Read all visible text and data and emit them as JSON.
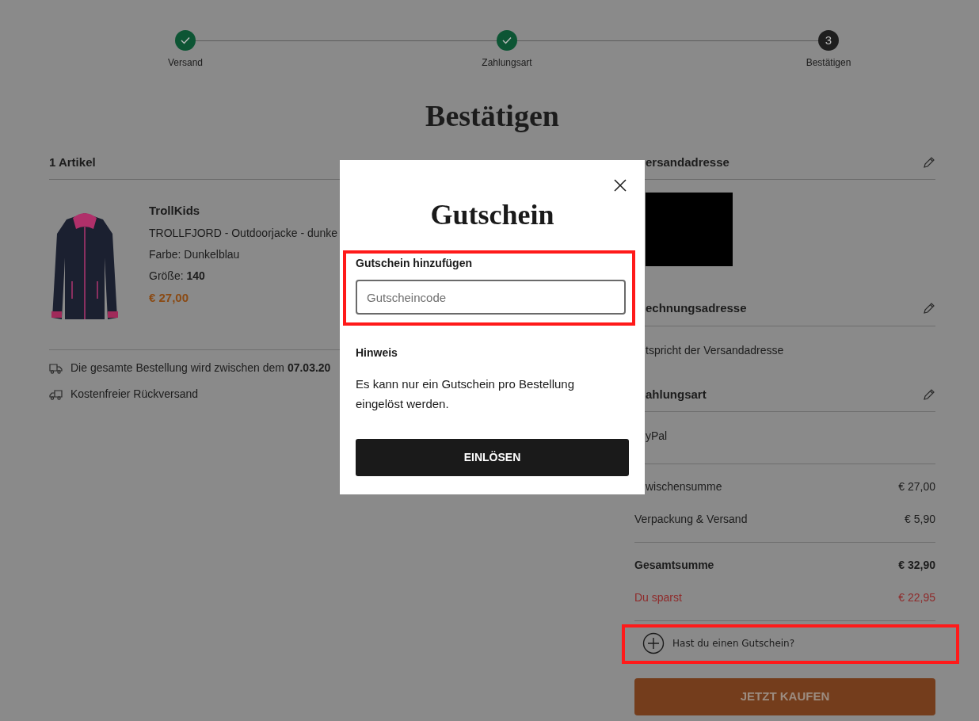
{
  "steps": [
    {
      "label": "Versand",
      "completed": true
    },
    {
      "label": "Zahlungsart",
      "completed": true
    },
    {
      "label": "Bestätigen",
      "number": "3",
      "completed": false
    }
  ],
  "title": "Bestätigen",
  "cart": {
    "heading": "1 Artikel",
    "items": [
      {
        "brand": "TrollKids",
        "name": "TROLLFJORD - Outdoorjacke - dunke",
        "variant": "Farbe: Dunkelblau",
        "size": "Größe: **140**",
        "price": "€ 27,00"
      }
    ]
  },
  "notes": [
    {
      "kind": "delivery",
      "text": "Die gesamte Bestellung wird zwischen dem **07.03.20**"
    },
    {
      "kind": "return",
      "text": "Kostenfreier Rückversand"
    }
  ],
  "sections": [
    {
      "title": "ersandadresse",
      "editable": true,
      "kind": "redacted"
    },
    {
      "title": "echnungsadresse",
      "editable": true,
      "kind": "text",
      "text": "tspricht der Versandadresse"
    },
    {
      "title": "ahlungsart",
      "editable": true,
      "kind": "text",
      "text": "yPal"
    }
  ],
  "totals": [
    {
      "label": "wischensumme",
      "value": "€ 27,00",
      "kind": "plain"
    },
    {
      "label": "Verpackung & Versand",
      "value": "€ 5,90",
      "kind": "plain"
    },
    {
      "label": "Gesamtsumme",
      "value": "€ 32,90",
      "kind": "total"
    },
    {
      "label": "Du sparst",
      "value": "€ 22,95",
      "kind": "savings"
    }
  ],
  "voucher_toggle": {
    "label": "Hast du einen Gutschein?"
  },
  "buy_button": "JETZT KAUFEN",
  "modal": {
    "title": "Gutschein",
    "field_label": "Gutschein hinzufügen",
    "placeholder": "Gutscheincode",
    "note_heading": "Hinweis",
    "note": "Es kann nur ein Gutschein pro Bestellung eingelöst werden.",
    "button": "EINLÖSEN"
  }
}
